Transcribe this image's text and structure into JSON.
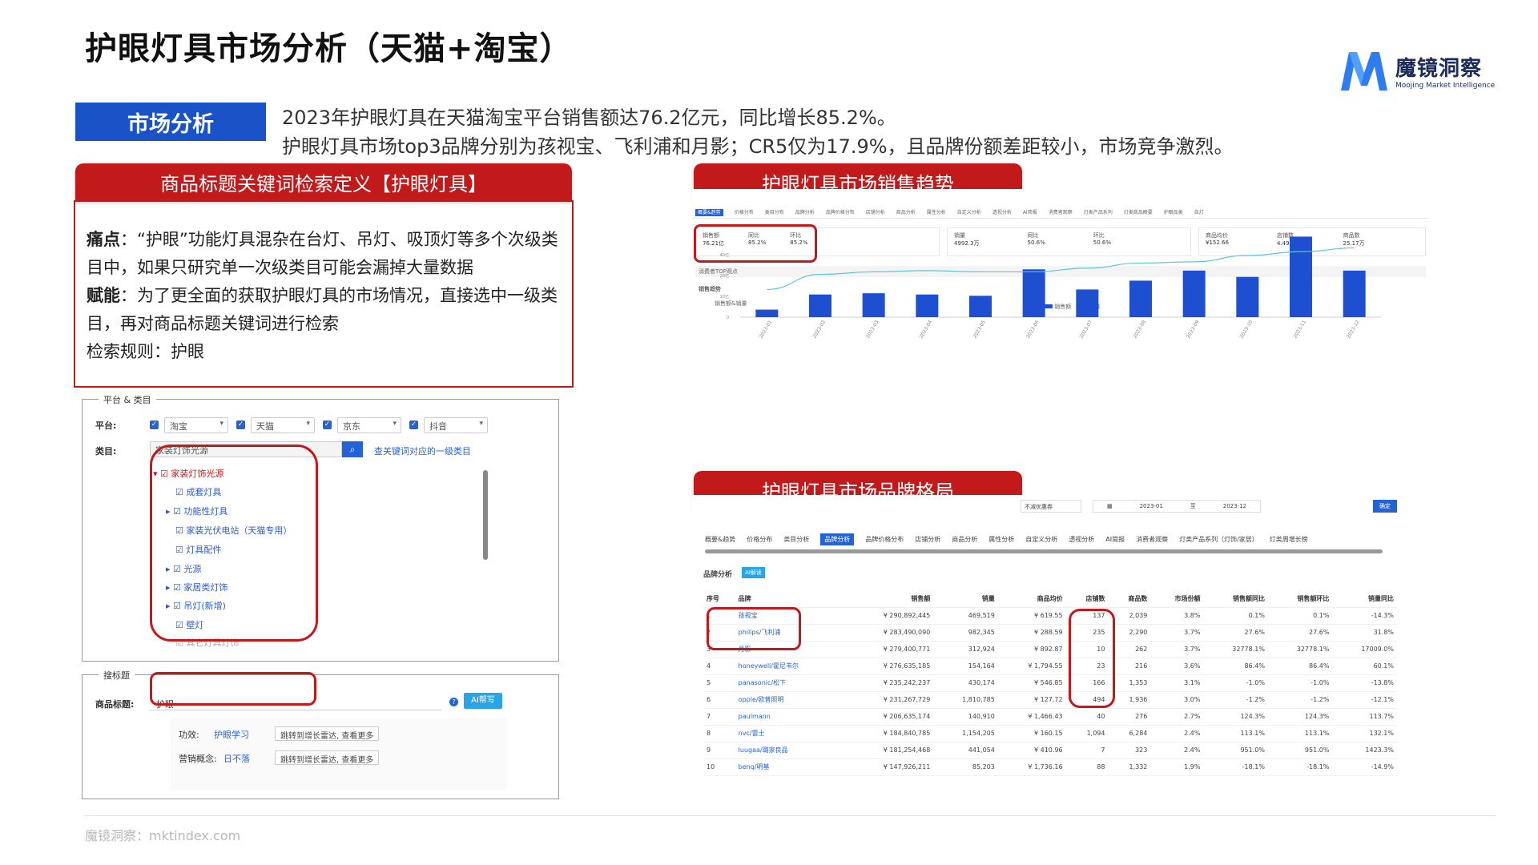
{
  "title": "护眼灯具市场分析（天猫+淘宝）",
  "logo": {
    "cn": "魔镜洞察",
    "en": "Moojing Market Intelligence"
  },
  "section_tag": "市场分析",
  "summary": [
    "2023年护眼灯具在天猫淘宝平台销售额达76.2亿元，同比增长85.2%。",
    "护眼灯具市场top3品牌分别为孩视宝、飞利浦和月影；CR5仅为17.9%，且品牌份额差距较小，市场竞争激烈。"
  ],
  "headers": {
    "keyword": "商品标题关键词检索定义【护眼灯具】",
    "trend": "护眼灯具市场销售趋势",
    "brand": "护眼灯具市场品牌格局"
  },
  "definition": {
    "pain_label": "痛点",
    "pain_text": "：“护眼”功能灯具混杂在台灯、吊灯、吸顶灯等多个次级类目中，如果只研究单一次级类目可能会漏掉大量数据",
    "enable_label": "赋能",
    "enable_text": "：为了更全面的获取护眼灯具的市场情况，直接选中一级类目，再对商品标题关键词进行检索",
    "rule": "检索规则：护眼"
  },
  "filter": {
    "legend": "平台 & 类目",
    "platform_label": "平台:",
    "platforms": [
      "淘宝",
      "天猫",
      "京东",
      "抖音"
    ],
    "category_label": "类目:",
    "category_value": "家装灯饰光源",
    "category_link": "查关键词对应的一级类目",
    "tree": [
      "家装灯饰光源",
      "成套灯具",
      "功能性灯具",
      "家装光伏电站（天猫专用）",
      "灯具配件",
      "光源",
      "家居类灯饰",
      "吊灯(新增)",
      "壁灯",
      "其它灯具灯饰"
    ]
  },
  "search": {
    "legend": "搜标题",
    "title_label": "商品标题:",
    "title_value": "护眼",
    "ai_button": "AI帮写",
    "effect_label": "功效:",
    "effect_link": "护眼学习",
    "effect_btn": "跳转到增长雷达, 查看更多",
    "concept_label": "营销概念:",
    "concept_link": "日不落",
    "concept_btn": "跳转到增长雷达, 查看更多"
  },
  "trend": {
    "tabs": [
      "概要&趋势",
      "价格分布",
      "类目分布",
      "品牌分析",
      "品牌价格分布",
      "店铺分析",
      "商品分析",
      "属性分析",
      "自定义分析",
      "透视分析",
      "AI简报",
      "消费者观察",
      "灯类产品系列",
      "灯类商品概要",
      "护眼品类",
      "自灯"
    ],
    "stats": [
      {
        "label": "销售额",
        "value": "76.21亿"
      },
      {
        "label": "同比",
        "value": "85.2%"
      },
      {
        "label": "环比",
        "value": "85.2%"
      },
      {
        "label": "销量",
        "value": "4992.3万"
      },
      {
        "label": "同比",
        "value": "50.6%"
      },
      {
        "label": "环比",
        "value": "50.6%"
      },
      {
        "label": "商品均价",
        "value": "¥152.66"
      },
      {
        "label": "店铺数",
        "value": "4.49万"
      },
      {
        "label": "商品数",
        "value": "25.17万"
      }
    ],
    "consumer_link": "消费者TOP观点",
    "chart_title": "销售趋势",
    "chart_sub": "销售额&销量",
    "legend": [
      "销售额",
      "销量"
    ]
  },
  "chart_data": {
    "type": "bar",
    "categories": [
      "2023-01",
      "2023-02",
      "2023-03",
      "2023-04",
      "2023-05",
      "2023-06",
      "2023-07",
      "2023-08",
      "2023-09",
      "2023-10",
      "2023-11",
      "2023-12"
    ],
    "series": [
      {
        "name": "销售额",
        "values": [
          0.6,
          1.8,
          1.9,
          1.8,
          1.7,
          3.8,
          2.2,
          2.9,
          3.7,
          3.2,
          6.4,
          3.7
        ]
      },
      {
        "name": "销量",
        "values": [
          2.2,
          3.4,
          3.6,
          3.7,
          3.6,
          3.6,
          3.9,
          4.3,
          4.4,
          4.9,
          5.2,
          5.5
        ]
      }
    ],
    "y_ticks": [
      "0",
      "10亿",
      "20亿",
      "40亿"
    ]
  },
  "brand": {
    "controls": {
      "mode": "不减优惠券",
      "start": "2023-01",
      "to": "至",
      "end": "2023-12",
      "confirm": "确定"
    },
    "tabs": [
      "概要&趋势",
      "价格分布",
      "类目分析",
      "品牌分析",
      "品牌价格分布",
      "店铺分析",
      "商品分析",
      "属性分析",
      "自定义分析",
      "透视分析",
      "AI简报",
      "消费者观察",
      "灯类产品系列（灯饰/家居）",
      "灯类周增长榜"
    ],
    "section": "品牌分析",
    "ai_badge": "AI解读",
    "columns": [
      "序号",
      "品牌",
      "销售额",
      "销量",
      "商品均价",
      "店铺数",
      "商品数",
      "市场份额",
      "销售额同比",
      "销售额环比",
      "销量同比"
    ],
    "rows": [
      [
        "1",
        "孩视宝",
        "¥ 290,892,445",
        "469,519",
        "¥ 619.55",
        "137",
        "2,039",
        "3.8%",
        "0.1%",
        "0.1%",
        "-14.3%"
      ],
      [
        "2",
        "philips/飞利浦",
        "¥ 283,490,090",
        "982,345",
        "¥ 288.59",
        "235",
        "2,290",
        "3.7%",
        "27.6%",
        "27.6%",
        "31.8%"
      ],
      [
        "3",
        "月影",
        "¥ 279,400,771",
        "312,924",
        "¥ 892.87",
        "10",
        "262",
        "3.7%",
        "32778.1%",
        "32778.1%",
        "17009.0%"
      ],
      [
        "4",
        "honeywell/霍尼韦尔",
        "¥ 276,635,185",
        "154,164",
        "¥ 1,794.55",
        "23",
        "216",
        "3.6%",
        "86.4%",
        "86.4%",
        "60.1%"
      ],
      [
        "5",
        "panasonic/松下",
        "¥ 235,242,237",
        "430,174",
        "¥ 546.85",
        "166",
        "1,353",
        "3.1%",
        "-1.0%",
        "-1.0%",
        "-13.8%"
      ],
      [
        "6",
        "opple/欧普照明",
        "¥ 231,267,729",
        "1,810,785",
        "¥ 127.72",
        "494",
        "1,936",
        "3.0%",
        "-1.2%",
        "-1.2%",
        "-12.1%"
      ],
      [
        "7",
        "paulmann",
        "¥ 206,635,174",
        "140,910",
        "¥ 1,466.43",
        "40",
        "276",
        "2.7%",
        "124.3%",
        "124.3%",
        "113.7%"
      ],
      [
        "8",
        "nvc/雷士",
        "¥ 184,840,785",
        "1,154,205",
        "¥ 160.15",
        "1,094",
        "6,284",
        "2.4%",
        "113.1%",
        "113.1%",
        "132.1%"
      ],
      [
        "9",
        "luugaa/璐家良品",
        "¥ 181,254,468",
        "441,054",
        "¥ 410.96",
        "7",
        "323",
        "2.4%",
        "951.0%",
        "951.0%",
        "1423.3%"
      ],
      [
        "10",
        "benq/明基",
        "¥ 147,926,211",
        "85,203",
        "¥ 1,736.16",
        "88",
        "1,332",
        "1.9%",
        "-18.1%",
        "-18.1%",
        "-14.9%"
      ]
    ]
  },
  "footer": "魔镜洞察：mktindex.com",
  "colors": {
    "brand_blue": "#1a53c8",
    "header_red": "#c21a1a",
    "bar_blue": "#1f4fd1",
    "line_cyan": "#5fc6d6"
  }
}
